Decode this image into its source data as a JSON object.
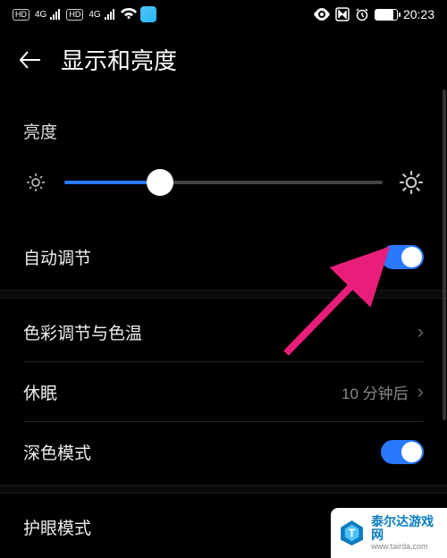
{
  "status": {
    "hd1": "HD",
    "hd2": "HD",
    "sig1": "4G",
    "sig2": "4G",
    "time": "20:23"
  },
  "header": {
    "title": "显示和亮度"
  },
  "brightness": {
    "label": "亮度",
    "value": 30
  },
  "rows": {
    "auto_adjust": {
      "label": "自动调节",
      "on": true
    },
    "color_temp": {
      "label": "色彩调节与色温"
    },
    "sleep": {
      "label": "休眠",
      "value": "10 分钟后"
    },
    "dark_mode": {
      "label": "深色模式",
      "on": true
    },
    "eye_comfort": {
      "label": "护眼模式"
    }
  },
  "watermark": {
    "title": "泰尔达游戏网",
    "sub": "www.tairda.com"
  }
}
